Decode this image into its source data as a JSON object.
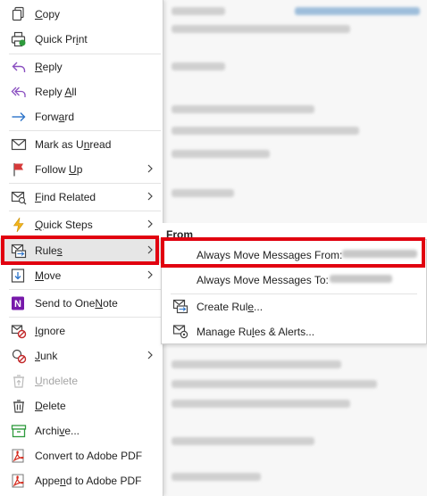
{
  "menu": {
    "items": [
      {
        "pre": "",
        "acc": "C",
        "post": "opy"
      },
      {
        "pre": "Quick Pr",
        "acc": "i",
        "post": "nt"
      },
      {
        "pre": "",
        "acc": "R",
        "post": "eply"
      },
      {
        "pre": "Reply ",
        "acc": "A",
        "post": "ll"
      },
      {
        "pre": "Forw",
        "acc": "a",
        "post": "rd"
      },
      {
        "pre": "Mark as U",
        "acc": "n",
        "post": "read"
      },
      {
        "pre": "Follow ",
        "acc": "U",
        "post": "p"
      },
      {
        "pre": "",
        "acc": "F",
        "post": "ind Related"
      },
      {
        "pre": "",
        "acc": "Q",
        "post": "uick Steps"
      },
      {
        "pre": "Rule",
        "acc": "s",
        "post": ""
      },
      {
        "pre": "",
        "acc": "M",
        "post": "ove"
      },
      {
        "pre": "Send to One",
        "acc": "N",
        "post": "ote"
      },
      {
        "pre": "",
        "acc": "I",
        "post": "gnore"
      },
      {
        "pre": "",
        "acc": "J",
        "post": "unk"
      },
      {
        "pre": "",
        "acc": "U",
        "post": "ndelete"
      },
      {
        "pre": "",
        "acc": "D",
        "post": "elete"
      },
      {
        "pre": "Archi",
        "acc": "v",
        "post": "e..."
      },
      {
        "pre": "Convert to Adobe PDF",
        "acc": "",
        "post": ""
      },
      {
        "pre": "Appe",
        "acc": "n",
        "post": "d to Adobe PDF"
      }
    ]
  },
  "submenu": {
    "from_label": "From",
    "items": [
      {
        "pre": "Always Move Messages From:",
        "acc": "",
        "post": ""
      },
      {
        "pre": "Always Move Messages To:",
        "acc": "",
        "post": ""
      },
      {
        "pre": "Create Rul",
        "acc": "e",
        "post": "..."
      },
      {
        "pre": "Manage Ru",
        "acc": "l",
        "post": "es & Alerts..."
      }
    ]
  },
  "colors": {
    "highlight_border": "#e1000f",
    "accent_blue": "#2b73c9",
    "menu_hover": "#e6e6e6"
  }
}
